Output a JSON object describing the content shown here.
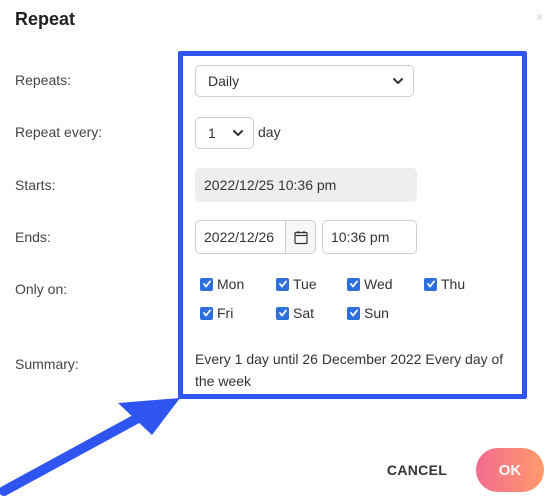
{
  "dialog": {
    "title": "Repeat",
    "close_symbol": "×",
    "labels": {
      "repeats": "Repeats:",
      "repeat_every": "Repeat every:",
      "starts": "Starts:",
      "ends": "Ends:",
      "only_on": "Only on:",
      "summary": "Summary:"
    },
    "repeats_value": "Daily",
    "repeat_every_value": "1",
    "repeat_every_unit": "day",
    "starts_value": "2022/12/25 10:36 pm",
    "ends_date": "2022/12/26",
    "ends_time": "10:36 pm",
    "days": [
      {
        "label": "Mon",
        "checked": true
      },
      {
        "label": "Tue",
        "checked": true
      },
      {
        "label": "Wed",
        "checked": true
      },
      {
        "label": "Thu",
        "checked": true
      },
      {
        "label": "Fri",
        "checked": true
      },
      {
        "label": "Sat",
        "checked": true
      },
      {
        "label": "Sun",
        "checked": true
      }
    ],
    "summary_text": "Every 1 day until 26 December 2022 Every day of the week",
    "cancel_label": "CANCEL",
    "ok_label": "OK"
  },
  "colors": {
    "highlight": "#2f55f0",
    "checkbox": "#2f6fdb",
    "ok_gradient_start": "#f26b8f",
    "ok_gradient_end": "#ff9b6a"
  },
  "icons": {
    "calendar": "calendar-icon",
    "chevron": "chevron-down-icon",
    "arrow": "annotation-arrow",
    "check": "checkmark-icon"
  }
}
